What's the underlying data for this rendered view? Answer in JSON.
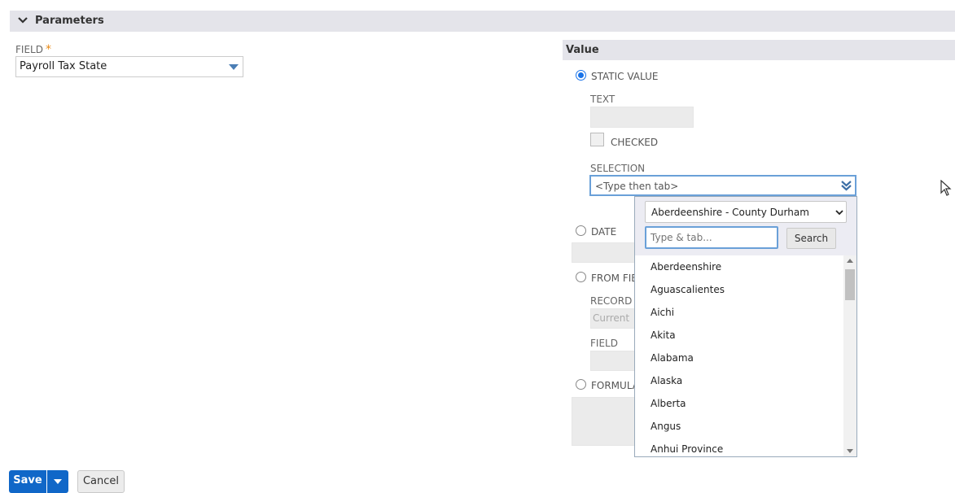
{
  "parameters": {
    "title": "Parameters"
  },
  "field": {
    "label": "FIELD",
    "required_mark": "*",
    "value": "Payroll Tax State"
  },
  "value_panel": {
    "title": "Value",
    "static_value": {
      "label": "STATIC VALUE",
      "selected": true
    },
    "text_label": "TEXT",
    "checked_label": "CHECKED",
    "selection_label": "SELECTION",
    "selection_placeholder": "<Type then tab>",
    "date_label": "DATE",
    "from_field_label": "FROM FIE",
    "record_label": "RECORD (",
    "record_value": "Current",
    "field2_label": "FIELD",
    "formula_label": "FORMULA"
  },
  "dropdown": {
    "range_select": "Aberdeenshire - County Durham",
    "search_placeholder": "Type & tab...",
    "search_button": "Search",
    "items": [
      "Aberdeenshire",
      "Aguascalientes",
      "Aichi",
      "Akita",
      "Alabama",
      "Alaska",
      "Alberta",
      "Angus",
      "Anhui Province"
    ]
  },
  "footer": {
    "save_label": "Save",
    "cancel_label": "Cancel"
  },
  "colors": {
    "accent": "#1067c8",
    "focus_border": "#6aa0d8",
    "section_bg": "#e4e4ea"
  }
}
